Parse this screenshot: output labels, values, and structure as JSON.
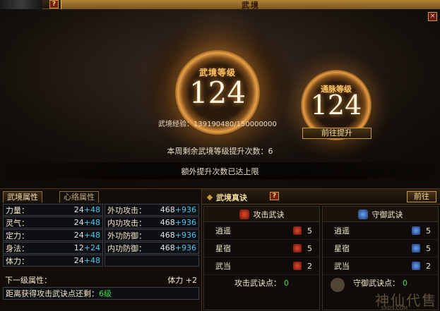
{
  "window": {
    "title": "武境",
    "help_glyph": "?",
    "close_glyph": "×"
  },
  "realm": {
    "level_label": "武境等级",
    "level_value": "124",
    "meridian_label": "通脉等级",
    "meridian_value": "124",
    "exp_text": "武境经验：139190480/150000000",
    "goto_label": "前往提升",
    "weekly_text": "本周剩余武境等级提升次数：6",
    "extra_text": "额外提升次数已达上限"
  },
  "left": {
    "tabs": [
      "武境属性",
      "心络属性"
    ],
    "attributes": [
      {
        "left_label": "力量：",
        "left_base": "24",
        "left_bonus": "+48",
        "right_label": "外功攻击：",
        "right_base": "468",
        "right_bonus": "+936"
      },
      {
        "left_label": "灵气：",
        "left_base": "24",
        "left_bonus": "+48",
        "right_label": "内功攻击：",
        "right_base": "468",
        "right_bonus": "+936"
      },
      {
        "left_label": "定力：",
        "left_base": "24",
        "left_bonus": "+48",
        "right_label": "外功防御：",
        "right_base": "468",
        "right_bonus": "+936"
      },
      {
        "left_label": "身法：",
        "left_base": "12",
        "left_bonus": "+24",
        "right_label": "内功防御：",
        "right_base": "468",
        "right_bonus": "+936"
      },
      {
        "left_label": "体力：",
        "left_base": "24",
        "left_bonus": "+48",
        "right_label": "",
        "right_base": "",
        "right_bonus": ""
      }
    ],
    "next_label": "下一级属性：",
    "next_value": "体力 +2",
    "dist_label": "距离获得攻击武诀点还剩：",
    "dist_value": "6级"
  },
  "right": {
    "title": "武境真诀",
    "goto_label": "前往",
    "attack": {
      "title": "攻击武诀",
      "rows": [
        {
          "name": "逍遥",
          "count": "5"
        },
        {
          "name": "星宿",
          "count": "5"
        },
        {
          "name": "武当",
          "count": "2"
        }
      ],
      "points_label": "攻击武诀点：",
      "points_value": "0"
    },
    "defense": {
      "title": "守御武诀",
      "rows": [
        {
          "name": "逍遥",
          "count": "5"
        },
        {
          "name": "星宿",
          "count": "5"
        },
        {
          "name": "武当",
          "count": "2"
        }
      ],
      "points_label": "守御武诀点：",
      "points_value": "0"
    }
  },
  "watermark": {
    "main": "神仙代售",
    "sub": "SXDS.COM"
  },
  "colors": {
    "gold": "#c89a40",
    "bonus_blue": "#4ac8f2",
    "green": "#3ee04a"
  }
}
